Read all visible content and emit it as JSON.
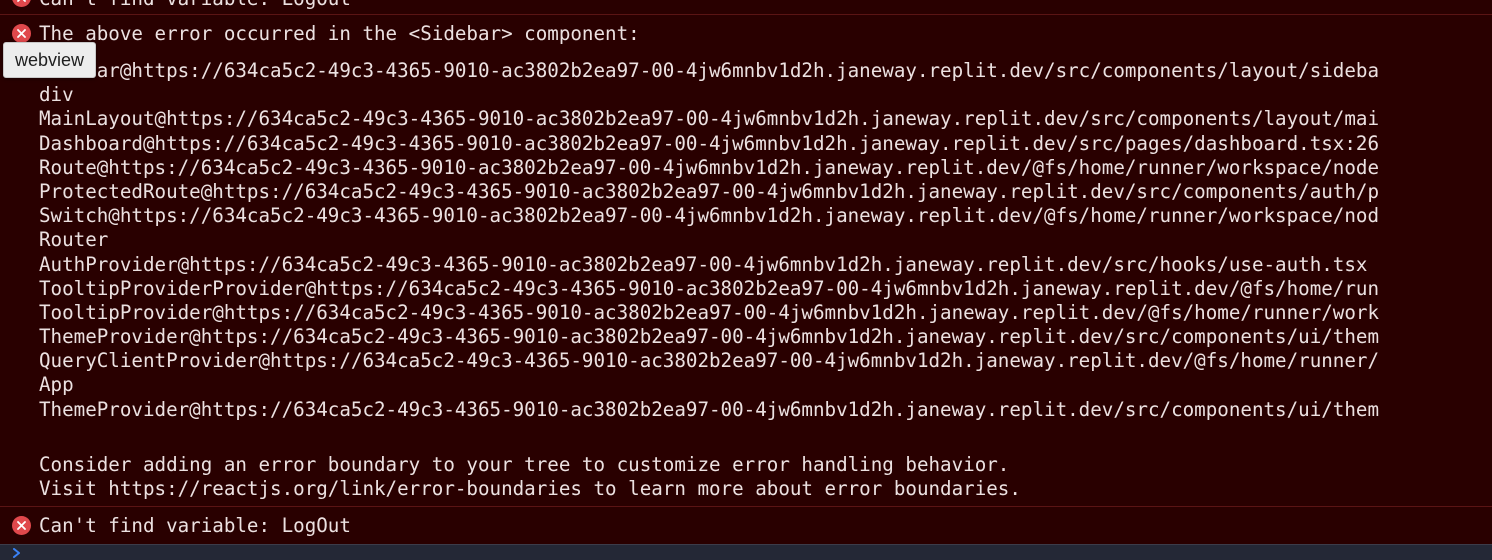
{
  "console": {
    "top_message": "Can't find variable: LogOut",
    "main_error": {
      "heading": "The above error occurred in the <Sidebar> component:",
      "stack": [
        "Sidebar@https://634ca5c2-49c3-4365-9010-ac3802b2ea97-00-4jw6mnbv1d2h.janeway.replit.dev/src/components/layout/sideba",
        "div",
        "MainLayout@https://634ca5c2-49c3-4365-9010-ac3802b2ea97-00-4jw6mnbv1d2h.janeway.replit.dev/src/components/layout/mai",
        "Dashboard@https://634ca5c2-49c3-4365-9010-ac3802b2ea97-00-4jw6mnbv1d2h.janeway.replit.dev/src/pages/dashboard.tsx:26",
        "Route@https://634ca5c2-49c3-4365-9010-ac3802b2ea97-00-4jw6mnbv1d2h.janeway.replit.dev/@fs/home/runner/workspace/node",
        "ProtectedRoute@https://634ca5c2-49c3-4365-9010-ac3802b2ea97-00-4jw6mnbv1d2h.janeway.replit.dev/src/components/auth/p",
        "Switch@https://634ca5c2-49c3-4365-9010-ac3802b2ea97-00-4jw6mnbv1d2h.janeway.replit.dev/@fs/home/runner/workspace/nod",
        "Router",
        "AuthProvider@https://634ca5c2-49c3-4365-9010-ac3802b2ea97-00-4jw6mnbv1d2h.janeway.replit.dev/src/hooks/use-auth.tsx",
        "TooltipProviderProvider@https://634ca5c2-49c3-4365-9010-ac3802b2ea97-00-4jw6mnbv1d2h.janeway.replit.dev/@fs/home/run",
        "TooltipProvider@https://634ca5c2-49c3-4365-9010-ac3802b2ea97-00-4jw6mnbv1d2h.janeway.replit.dev/@fs/home/runner/work",
        "ThemeProvider@https://634ca5c2-49c3-4365-9010-ac3802b2ea97-00-4jw6mnbv1d2h.janeway.replit.dev/src/components/ui/them",
        "QueryClientProvider@https://634ca5c2-49c3-4365-9010-ac3802b2ea97-00-4jw6mnbv1d2h.janeway.replit.dev/@fs/home/runner/",
        "App",
        "ThemeProvider@https://634ca5c2-49c3-4365-9010-ac3802b2ea97-00-4jw6mnbv1d2h.janeway.replit.dev/src/components/ui/them"
      ],
      "hint_lines": [
        "Consider adding an error boundary to your tree to customize error handling behavior.",
        "Visit https://reactjs.org/link/error-boundaries to learn more about error boundaries."
      ]
    },
    "last_message": "Can't find variable: LogOut"
  },
  "tooltip": {
    "label": "webview"
  },
  "colors": {
    "background": "#290000",
    "error_icon": "#e0484c",
    "text": "#ece1e1",
    "divider": "#5a1414",
    "prompt_bar": "#242836",
    "prompt_chevron": "#3b82f6"
  },
  "icons": {
    "error": "error-circle-x-icon",
    "prompt": "chevron-right-icon"
  }
}
